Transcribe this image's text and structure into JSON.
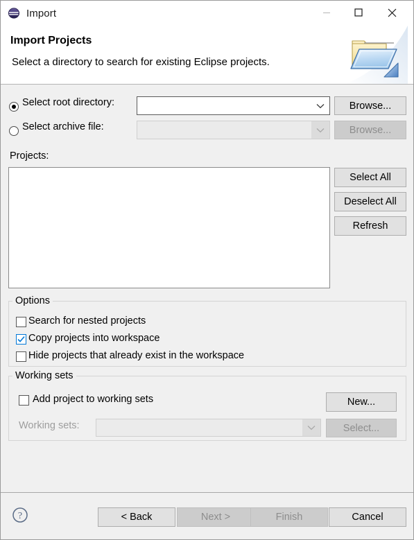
{
  "window": {
    "title": "Import",
    "app_icon": "eclipse-icon",
    "controls": {
      "minimize": "minimize-icon",
      "maximize": "maximize-icon",
      "close": "close-icon"
    }
  },
  "banner": {
    "title": "Import Projects",
    "description": "Select a directory to search for existing Eclipse projects.",
    "icon": "open-folder-icon"
  },
  "source": {
    "root_directory": {
      "label": "Select root directory:",
      "selected": true,
      "value": "",
      "browse_label": "Browse...",
      "browse_enabled": true
    },
    "archive_file": {
      "label": "Select archive file:",
      "selected": false,
      "value": "",
      "browse_label": "Browse...",
      "browse_enabled": false
    }
  },
  "projects": {
    "label": "Projects:",
    "items": [],
    "buttons": {
      "select_all": "Select All",
      "deselect_all": "Deselect All",
      "refresh": "Refresh"
    }
  },
  "options": {
    "group_label": "Options",
    "items": [
      {
        "label": "Search for nested projects",
        "checked": false
      },
      {
        "label": "Copy projects into workspace",
        "checked": true
      },
      {
        "label": "Hide projects that already exist in the workspace",
        "checked": false
      }
    ]
  },
  "working_sets": {
    "group_label": "Working sets",
    "add_checkbox": {
      "label": "Add project to working sets",
      "checked": false
    },
    "new_button": "New...",
    "combo_label": "Working sets:",
    "combo_value": "",
    "combo_enabled": false,
    "select_button": "Select...",
    "select_enabled": false
  },
  "footer": {
    "help": "help-icon",
    "back": {
      "label": "< Back",
      "enabled": true
    },
    "next": {
      "label": "Next >",
      "enabled": false
    },
    "finish": {
      "label": "Finish",
      "enabled": false
    },
    "cancel": {
      "label": "Cancel",
      "enabled": true
    }
  },
  "colors": {
    "accent": "#0078d7",
    "dialog_bg": "#f0f0f0",
    "header_bg": "#ffffff",
    "disabled_text": "#8d8d8d"
  }
}
